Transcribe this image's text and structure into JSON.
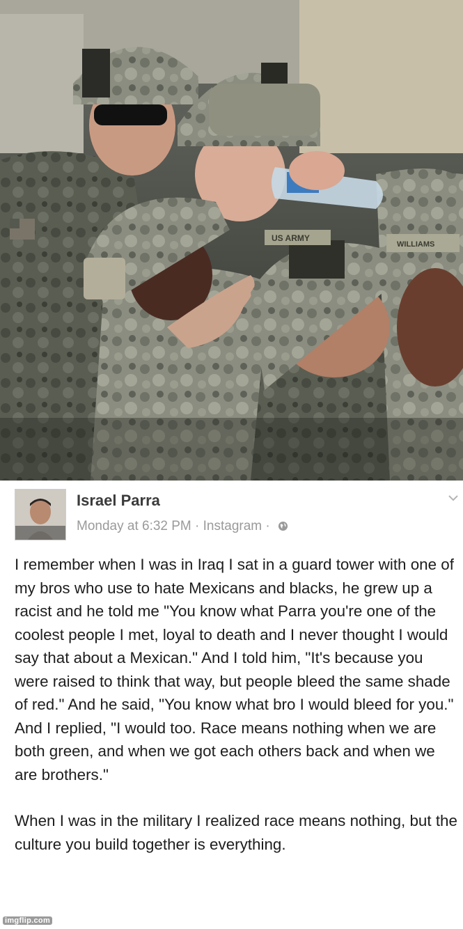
{
  "post": {
    "author": "Israel Parra",
    "timestamp": "Monday at 6:32 PM",
    "source": "Instagram",
    "separator": "·",
    "privacy_icon": "globe-icon",
    "options_icon": "chevron-down-icon",
    "paragraphs": [
      "I remember when I was in Iraq I sat in a guard tower with one of my bros who use to hate Mexicans and blacks, he grew up a racist and he told me \"You know what Parra you're one of the coolest people I met, loyal to death and I never thought I would say that about a Mexican.\" And I told him, \"It's because you were raised to think that way, but people bleed the same shade of red.\" And he said, \"You know what bro I would bleed for you.\" And I replied, \"I would too. Race means nothing when we are both green, and when we got each others back and when we are brothers.\"",
      "When I was in the military I realized race means nothing, but the culture you build together is everything."
    ]
  },
  "photo": {
    "helmet_tape_1": "US ARMY",
    "helmet_tape_2": "WILLIAMS"
  },
  "watermark": "imgflip.com",
  "colors": {
    "author_text": "#3b3b3b",
    "meta_text": "#9a9a9a",
    "body_text": "#1d1d1d"
  }
}
